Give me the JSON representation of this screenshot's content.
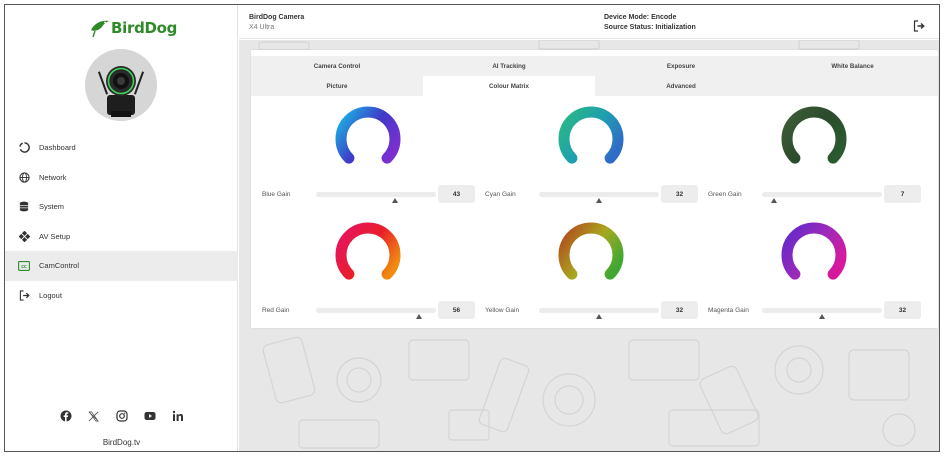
{
  "brand": {
    "name": "BirdDog",
    "site": "BirdDog.tv",
    "accent": "#2f8a2a"
  },
  "sidebar": {
    "items": [
      {
        "label": "Dashboard",
        "icon": "dashboard-icon"
      },
      {
        "label": "Network",
        "icon": "globe-icon"
      },
      {
        "label": "System",
        "icon": "database-icon"
      },
      {
        "label": "AV Setup",
        "icon": "av-setup-icon"
      },
      {
        "label": "CamControl",
        "icon": "cc-icon",
        "active": true
      },
      {
        "label": "Logout",
        "icon": "logout-icon"
      }
    ],
    "social": [
      "facebook-icon",
      "x-icon",
      "instagram-icon",
      "youtube-icon",
      "linkedin-icon"
    ]
  },
  "header": {
    "camera_name": "BirdDog Camera",
    "camera_model": "X4 Ultra",
    "device_mode": "Device Mode: Encode",
    "source_status": "Source Status: Initialization"
  },
  "tabs": {
    "row1": [
      "Camera Control",
      "AI Tracking",
      "Exposure",
      "White Balance"
    ],
    "row2": [
      "Picture",
      "Colour Matrix",
      "Advanced"
    ],
    "active": "Colour Matrix"
  },
  "gains": [
    {
      "label": "Blue Gain",
      "value": "43",
      "level": 0.66,
      "colors": [
        "#1fa4e0",
        "#3f39c8",
        "#7a2fd0"
      ]
    },
    {
      "label": "Cyan Gain",
      "value": "32",
      "level": 0.5,
      "colors": [
        "#29b48a",
        "#1e9fb0",
        "#2f6bc8"
      ]
    },
    {
      "label": "Green Gain",
      "value": "7",
      "level": 0.1,
      "colors": [
        "#3a5a36",
        "#2c4a2c",
        "#2a5a30"
      ]
    },
    {
      "label": "Red Gain",
      "value": "56",
      "level": 0.86,
      "colors": [
        "#e6155a",
        "#e81e2a",
        "#f08a10"
      ]
    },
    {
      "label": "Yellow Gain",
      "value": "32",
      "level": 0.5,
      "colors": [
        "#b2561e",
        "#a8a81e",
        "#3ea832"
      ]
    },
    {
      "label": "Magenta Gain",
      "value": "32",
      "level": 0.5,
      "colors": [
        "#6a2ac8",
        "#9e2ab8",
        "#d8189c"
      ]
    }
  ]
}
